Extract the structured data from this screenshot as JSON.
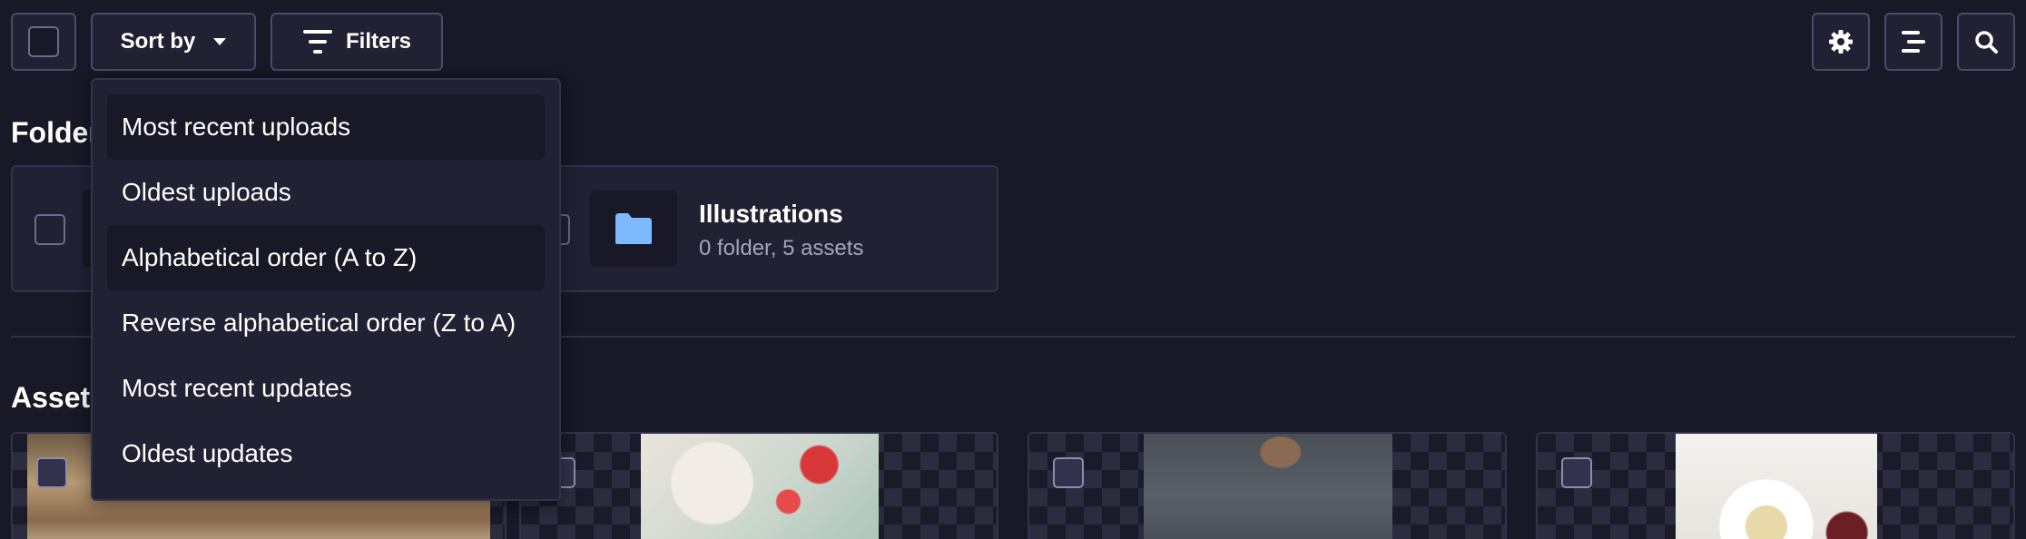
{
  "toolbar": {
    "select_all_checked": false,
    "sort_label": "Sort by",
    "filters_label": "Filters",
    "icons": [
      "gear-icon",
      "list-view-icon",
      "search-icon"
    ]
  },
  "sort_menu": {
    "items": [
      {
        "label": "Most recent uploads",
        "highlighted": true
      },
      {
        "label": "Oldest uploads",
        "highlighted": false
      },
      {
        "label": "Alphabetical order (A to Z)",
        "highlighted": true
      },
      {
        "label": "Reverse alphabetical order (Z to A)",
        "highlighted": false
      },
      {
        "label": "Most recent updates",
        "highlighted": false
      },
      {
        "label": "Oldest updates",
        "highlighted": false
      }
    ]
  },
  "folders": {
    "title": "Folders",
    "items": [
      {
        "name": "Illustrations",
        "meta": "0 folder, 5 assets",
        "icon": "folder-icon"
      }
    ]
  },
  "assets": {
    "title": "Assets"
  },
  "colors": {
    "background": "#181826",
    "surface": "#212134",
    "border": "#32324d",
    "folder_icon": "#7cb9ff",
    "muted_text": "#a5a5ba"
  }
}
